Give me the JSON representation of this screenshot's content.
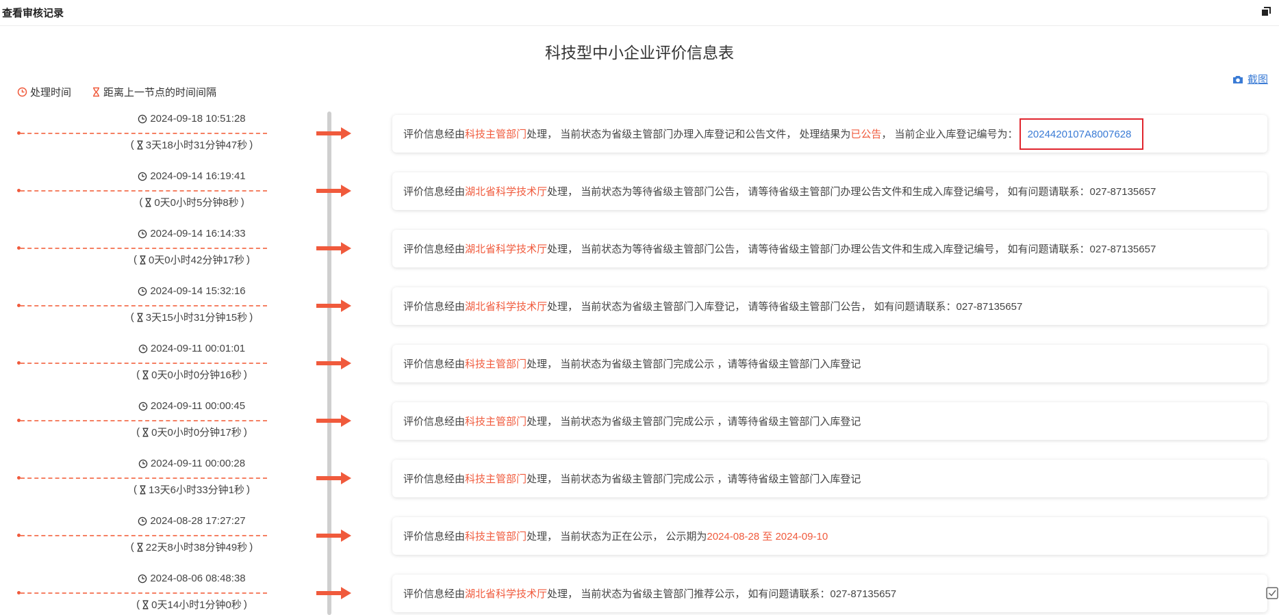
{
  "window": {
    "title": "查看审核记录"
  },
  "page": {
    "title": "科技型中小企业评价信息表"
  },
  "toolbar": {
    "screenshot_label": "截图"
  },
  "legend": {
    "process_time": "处理时间",
    "interval": "距离上一节点的时间间隔"
  },
  "colors": {
    "accent": "#f05a3c",
    "link": "#3a7bd5",
    "highlight_border": "#e0242d"
  },
  "entries": [
    {
      "time": "2024-09-18 10:51:28",
      "interval": "3天18小时31分钟47秒",
      "prefix": "评价信息经由",
      "dept": "科技主管部门",
      "body": "处理， 当前状态为省级主管部门办理入库登记和公告文件， 处理结果为",
      "result": "已公告",
      "tail": "， 当前企业入库登记编号为：",
      "code": "2024420107A8007628"
    },
    {
      "time": "2024-09-14 16:19:41",
      "interval": "0天0小时5分钟8秒",
      "prefix": "评价信息经由",
      "dept": "湖北省科学技术厅",
      "body": "处理， 当前状态为等待省级主管部门公告， 请等待省级主管部门办理公告文件和生成入库登记编号， 如有问题请联系：027-87135657"
    },
    {
      "time": "2024-09-14 16:14:33",
      "interval": "0天0小时42分钟17秒",
      "prefix": "评价信息经由",
      "dept": "湖北省科学技术厅",
      "body": "处理， 当前状态为等待省级主管部门公告， 请等待省级主管部门办理公告文件和生成入库登记编号， 如有问题请联系：027-87135657"
    },
    {
      "time": "2024-09-14 15:32:16",
      "interval": "3天15小时31分钟15秒",
      "prefix": "评价信息经由",
      "dept": "湖北省科学技术厅",
      "body": "处理， 当前状态为省级主管部门入库登记， 请等待省级主管部门公告， 如有问题请联系：027-87135657"
    },
    {
      "time": "2024-09-11 00:01:01",
      "interval": "0天0小时0分钟16秒",
      "prefix": "评价信息经由",
      "dept": "科技主管部门",
      "body": "处理， 当前状态为省级主管部门完成公示 ，请等待省级主管部门入库登记"
    },
    {
      "time": "2024-09-11 00:00:45",
      "interval": "0天0小时0分钟17秒",
      "prefix": "评价信息经由",
      "dept": "科技主管部门",
      "body": "处理， 当前状态为省级主管部门完成公示 ，请等待省级主管部门入库登记"
    },
    {
      "time": "2024-09-11 00:00:28",
      "interval": "13天6小时33分钟1秒",
      "prefix": "评价信息经由",
      "dept": "科技主管部门",
      "body": "处理， 当前状态为省级主管部门完成公示 ，请等待省级主管部门入库登记"
    },
    {
      "time": "2024-08-28 17:27:27",
      "interval": "22天8小时38分钟49秒",
      "prefix": "评价信息经由",
      "dept": "科技主管部门",
      "body": "处理， 当前状态为正在公示， 公示期为",
      "period": "2024-08-28 至 2024-09-10"
    },
    {
      "time": "2024-08-06 08:48:38",
      "interval": "0天14小时1分钟0秒",
      "prefix": "评价信息经由",
      "dept": "湖北省科学技术厅",
      "body": "处理， 当前状态为省级主管部门推荐公示， 如有问题请联系：027-87135657"
    }
  ]
}
